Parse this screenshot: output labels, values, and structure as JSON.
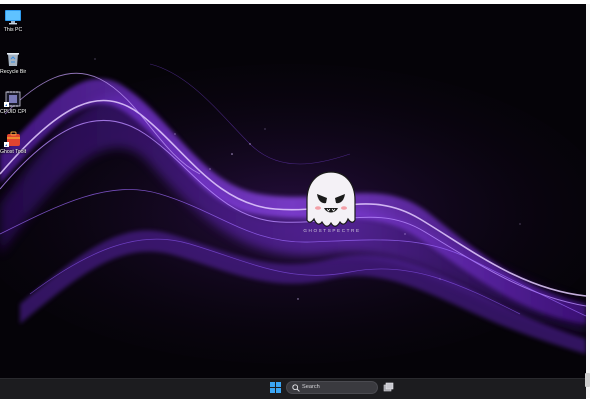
{
  "desktop": {
    "icons": [
      {
        "label": "This PC",
        "icon": "monitor-icon"
      },
      {
        "label": "Recycle Bin",
        "icon": "recycle-bin-icon"
      },
      {
        "label": "CPUID CPU-Z",
        "icon": "cpu-z-icon"
      },
      {
        "label": "Ghost Toolbox",
        "icon": "ghost-toolbox-icon"
      }
    ],
    "wallpaper": {
      "brand": "GHOSTSPECTRE",
      "colors": {
        "background": "#050308",
        "accent": "#8a3cff",
        "highlight": "#e2c8ff"
      }
    }
  },
  "taskbar": {
    "search_label": "Search",
    "start_icon": "windows-start-icon",
    "taskview_icon": "task-view-icon",
    "colors": {
      "background": "#1c1c1f",
      "start": "#3ba6f5"
    }
  }
}
